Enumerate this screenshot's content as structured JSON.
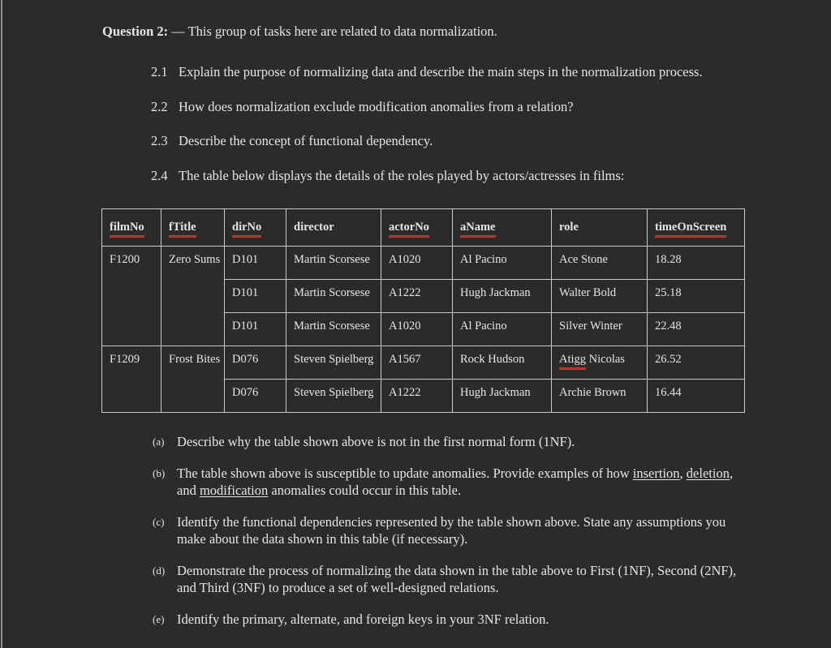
{
  "document": {
    "background_color": "#2b2b2b",
    "text_color": "#e8e6e3",
    "spellcheck_color": "#d83a2a",
    "border_color": "#c9c9c9"
  },
  "heading": {
    "label": "Question 2:",
    "dash": " — ",
    "text": "This group of tasks here are related to data normalization."
  },
  "numbered_items": [
    {
      "num": "2.1",
      "text": "Explain the purpose of normalizing data and describe the main steps in the normalization process."
    },
    {
      "num": "2.2",
      "text": "How does normalization exclude modification anomalies from a relation?"
    },
    {
      "num": "2.3",
      "text": "Describe the concept of functional dependency."
    },
    {
      "num": "2.4",
      "text": "The table below displays the details of the roles played by actors/actresses in films:"
    }
  ],
  "table": {
    "headers": [
      {
        "label": "filmNo",
        "misspelled": true
      },
      {
        "label": "fTitle",
        "misspelled": true
      },
      {
        "label": "dirNo",
        "misspelled": true
      },
      {
        "label": "director",
        "misspelled": false
      },
      {
        "label": "actorNo",
        "misspelled": true
      },
      {
        "label": "aName",
        "misspelled": true
      },
      {
        "label": "role",
        "misspelled": false
      },
      {
        "label": "timeOnScreen",
        "misspelled": true
      }
    ],
    "rows": [
      {
        "filmNo": "F1200",
        "fTitle": "Zero Sums",
        "filmRowspan": 3,
        "dirNo": "D101",
        "director": "Martin Scorsese",
        "actorNo": "A1020",
        "aName": "Al Pacino",
        "role": "Ace Stone",
        "role_misspelled": false,
        "timeOnScreen": "18.28"
      },
      {
        "dirNo": "D101",
        "director": "Martin Scorsese",
        "actorNo": "A1222",
        "aName": "Hugh Jackman",
        "role": "Walter Bold",
        "role_misspelled": false,
        "timeOnScreen": "25.18"
      },
      {
        "dirNo": "D101",
        "director": "Martin Scorsese",
        "actorNo": "A1020",
        "aName": "Al Pacino",
        "role": "Silver Winter",
        "role_misspelled": false,
        "timeOnScreen": "22.48"
      },
      {
        "filmNo": "F1209",
        "fTitle": "Frost Bites",
        "filmRowspan": 2,
        "dirNo": "D076",
        "director": "Steven Spielberg",
        "actorNo": "A1567",
        "aName": "Rock Hudson",
        "role": "Atigg Nicolas",
        "role_misspelled": true,
        "role_misspelled_word": "Atigg",
        "role_rest": " Nicolas",
        "timeOnScreen": "26.52"
      },
      {
        "dirNo": "D076",
        "director": "Steven Spielberg",
        "actorNo": "A1222",
        "aName": "Hugh Jackman",
        "role": "Archie Brown",
        "role_misspelled": false,
        "timeOnScreen": "16.44"
      }
    ]
  },
  "lettered_items": [
    {
      "letter": "(a)",
      "segments": [
        {
          "text": "Describe why the table shown above is not in the first normal form (1NF).",
          "underline": false
        }
      ]
    },
    {
      "letter": "(b)",
      "segments": [
        {
          "text": "The table shown above is susceptible to update anomalies. Provide examples of how ",
          "underline": false
        },
        {
          "text": "insertion",
          "underline": true
        },
        {
          "text": ", ",
          "underline": false
        },
        {
          "text": "deletion",
          "underline": true
        },
        {
          "text": ", and ",
          "underline": false
        },
        {
          "text": "modification",
          "underline": true
        },
        {
          "text": " anomalies could occur in this table.",
          "underline": false
        }
      ]
    },
    {
      "letter": "(c)",
      "segments": [
        {
          "text": "Identify the functional dependencies represented by the table shown above. State any assumptions you make about the data shown in this table (if necessary).",
          "underline": false
        }
      ]
    },
    {
      "letter": "(d)",
      "segments": [
        {
          "text": "Demonstrate the process of normalizing the data shown in the table above to First (1NF), Second (2NF), and Third (3NF) to produce a set of well-designed relations.",
          "underline": false
        }
      ]
    },
    {
      "letter": "(e)",
      "segments": [
        {
          "text": "Identify the primary, alternate, and foreign keys in your 3NF relation.",
          "underline": false
        }
      ]
    }
  ]
}
